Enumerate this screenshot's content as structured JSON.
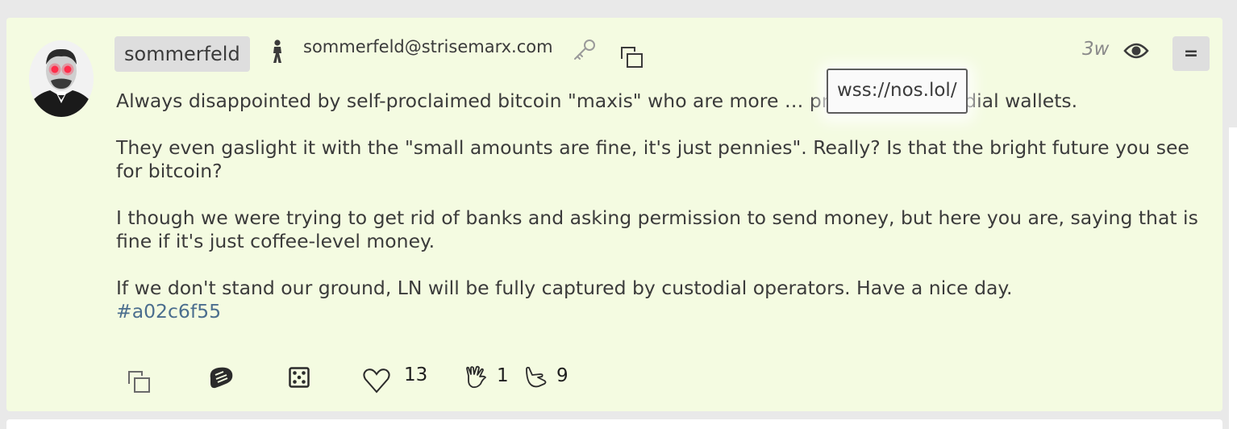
{
  "author": {
    "username": "sommerfeld",
    "nip05": "sommerfeld@strisemarx.com",
    "avatar_icon": "avatar-portrait-laser-eyes"
  },
  "timestamp": "3w",
  "menu_label": "=",
  "tooltip": "wss://nos.lol/",
  "post": {
    "paragraphs": [
      "Always disappointed by self-proclaimed bitcoin \"maxis\" who are more … promoting custodial wallets.",
      "They even gaslight it with the \"small amounts are fine, it's just pennies\". Really? Is that the bright future you see for bitcoin?",
      "I though we were trying to get rid of banks and asking permission to send money, but here you are, saying that is fine if it's just coffee-level money.",
      "If we don't stand our ground, LN will be fully captured by custodial operators. Have a nice day."
    ],
    "hashtag": "#a02c6f55"
  },
  "actions": {
    "copy_icon": "copy-icon",
    "zap_icon": "steak-icon",
    "random_icon": "dice-icon",
    "like_icon": "heart-icon",
    "like_count": "13",
    "reaction1_icon": "vulcan-salute-icon",
    "reaction1_count": "1",
    "reaction2_icon": "call-me-hand-icon",
    "reaction2_count": "9"
  },
  "colors": {
    "card_background": "#f4fbe1",
    "badge_background": "#dedede",
    "hashtag": "#4b6e8e",
    "timestamp": "#8a8a8a"
  }
}
